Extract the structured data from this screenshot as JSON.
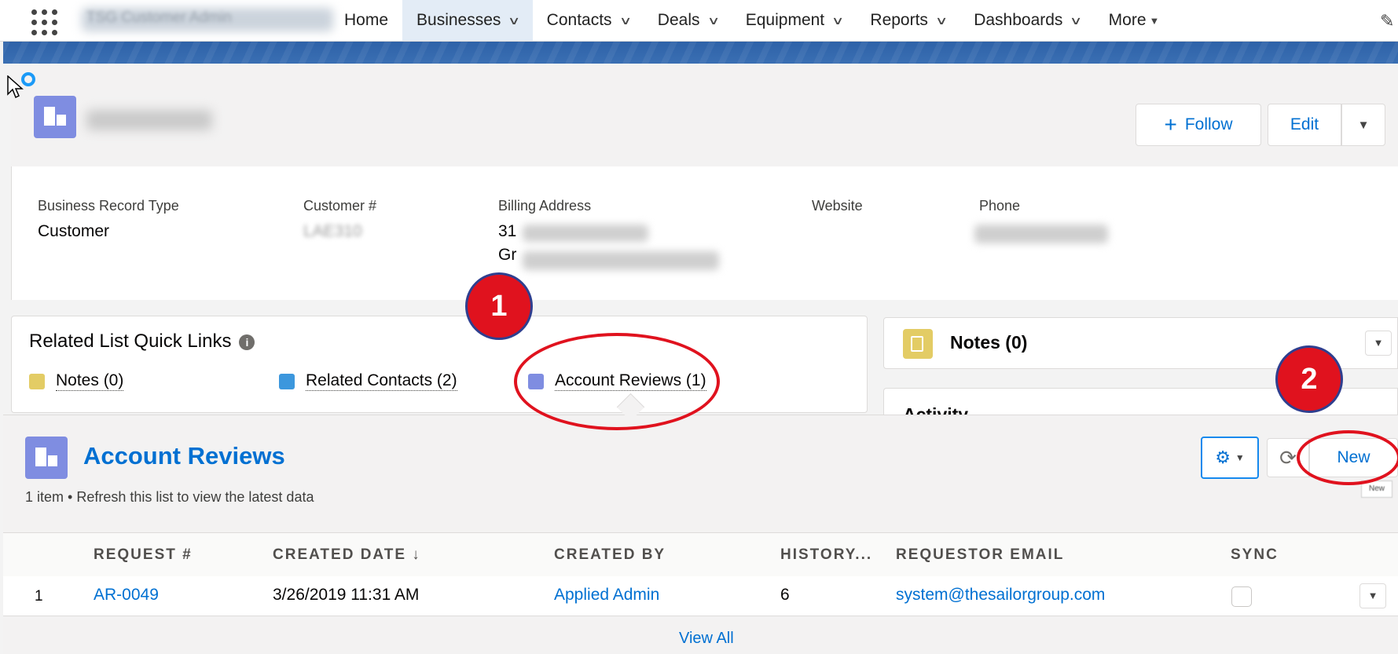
{
  "nav": {
    "app_name": "TSG Customer Admin",
    "items": [
      {
        "label": "Home",
        "dropdown": false
      },
      {
        "label": "Businesses",
        "dropdown": true,
        "active": true
      },
      {
        "label": "Contacts",
        "dropdown": true
      },
      {
        "label": "Deals",
        "dropdown": true
      },
      {
        "label": "Equipment",
        "dropdown": true
      },
      {
        "label": "Reports",
        "dropdown": true
      },
      {
        "label": "Dashboards",
        "dropdown": true
      }
    ],
    "more_label": "More"
  },
  "record": {
    "actions": {
      "follow": "Follow",
      "edit": "Edit"
    },
    "fields": [
      {
        "label": "Business Record Type",
        "value": "Customer"
      },
      {
        "label": "Customer #",
        "value": "LAE310"
      },
      {
        "label": "Billing Address",
        "value": "31",
        "value_line2": "Gr"
      },
      {
        "label": "Website",
        "value": ""
      },
      {
        "label": "Phone",
        "value": ""
      }
    ]
  },
  "quick_links": {
    "title": "Related List Quick Links",
    "links": [
      {
        "label": "Notes (0)",
        "color": "#e3cc65"
      },
      {
        "label": "Related Contacts (2)",
        "color": "#3c97dd"
      },
      {
        "label": "Account Reviews (1)",
        "color": "#7f8de1"
      }
    ]
  },
  "side": {
    "notes_title": "Notes (0)",
    "activity_title": "Activity"
  },
  "related_list": {
    "title": "Account Reviews",
    "subtitle": "1 item • Refresh this list to view the latest data",
    "new_label": "New",
    "tooltip": "New",
    "columns": [
      "REQUEST #",
      "CREATED DATE ↓",
      "CREATED BY",
      "HISTORY...",
      "REQUESTOR EMAIL",
      "SYNC"
    ],
    "rows": [
      {
        "index": "1",
        "request": "AR-0049",
        "created_date": "3/26/2019 11:31 AM",
        "created_by": "Applied Admin",
        "history": "6",
        "email": "system@thesailorgroup.com",
        "sync": false
      }
    ],
    "view_all": "View All"
  },
  "annotations": {
    "step1": "1",
    "step2": "2",
    "color": "#e0121e"
  }
}
